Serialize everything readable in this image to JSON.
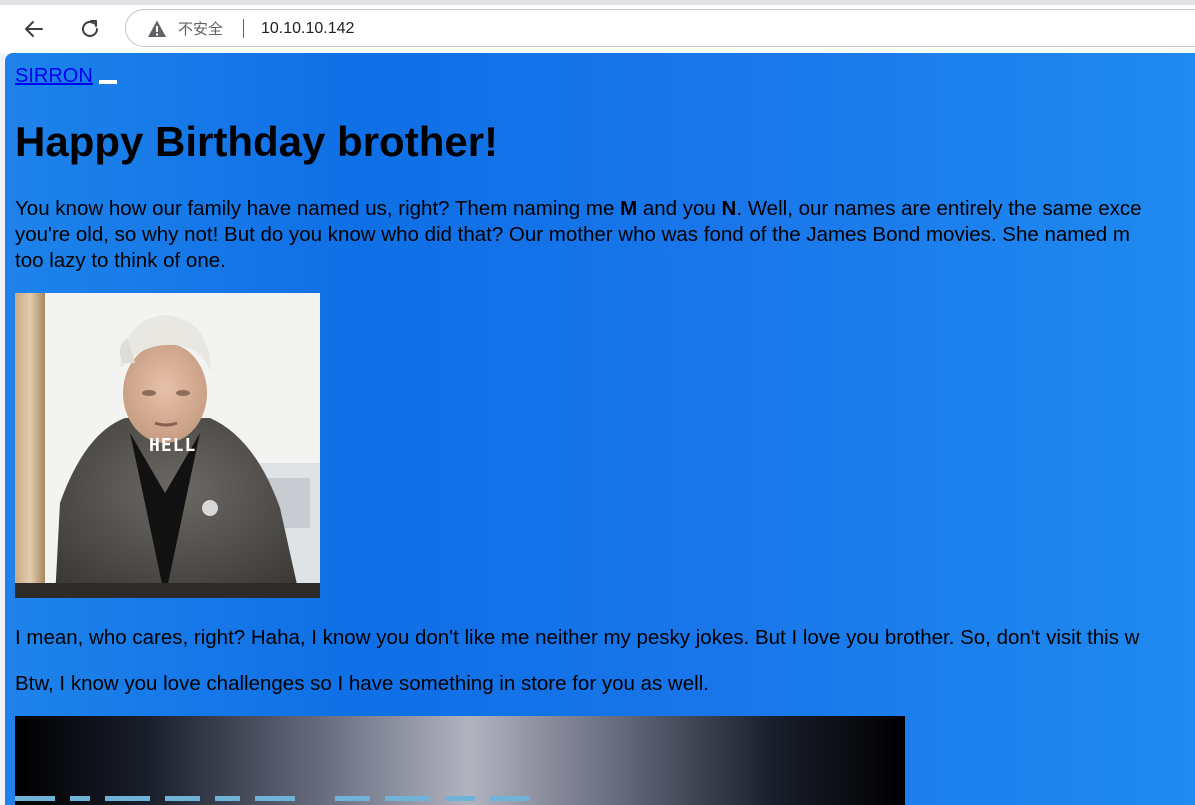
{
  "browser": {
    "security_label": "不安全",
    "url": "10.10.10.142"
  },
  "page": {
    "nav_link": "SIRRON",
    "heading": "Happy Birthday brother!",
    "paragraph1": {
      "line1_a": "You know how our family have named us, right? Them naming me ",
      "line1_bold1": "M",
      "line1_b": " and you ",
      "line1_bold2": "N",
      "line1_c": ". Well, our names are entirely the same exce",
      "line2": "you're old, so why not! But do you know who did that? Our mother who was fond of the James Bond movies. She named m",
      "line3": "too lazy to think of one."
    },
    "photo_caption": "HELL",
    "paragraph2": "I mean, who cares, right? Haha, I know you don't like me neither my pesky jokes. But I love you brother. So, don't visit this w",
    "paragraph3": "Btw, I know you love challenges so I have something in store for you as well."
  },
  "colors": {
    "page_background": "#1976ea",
    "link": "#0000ee"
  }
}
